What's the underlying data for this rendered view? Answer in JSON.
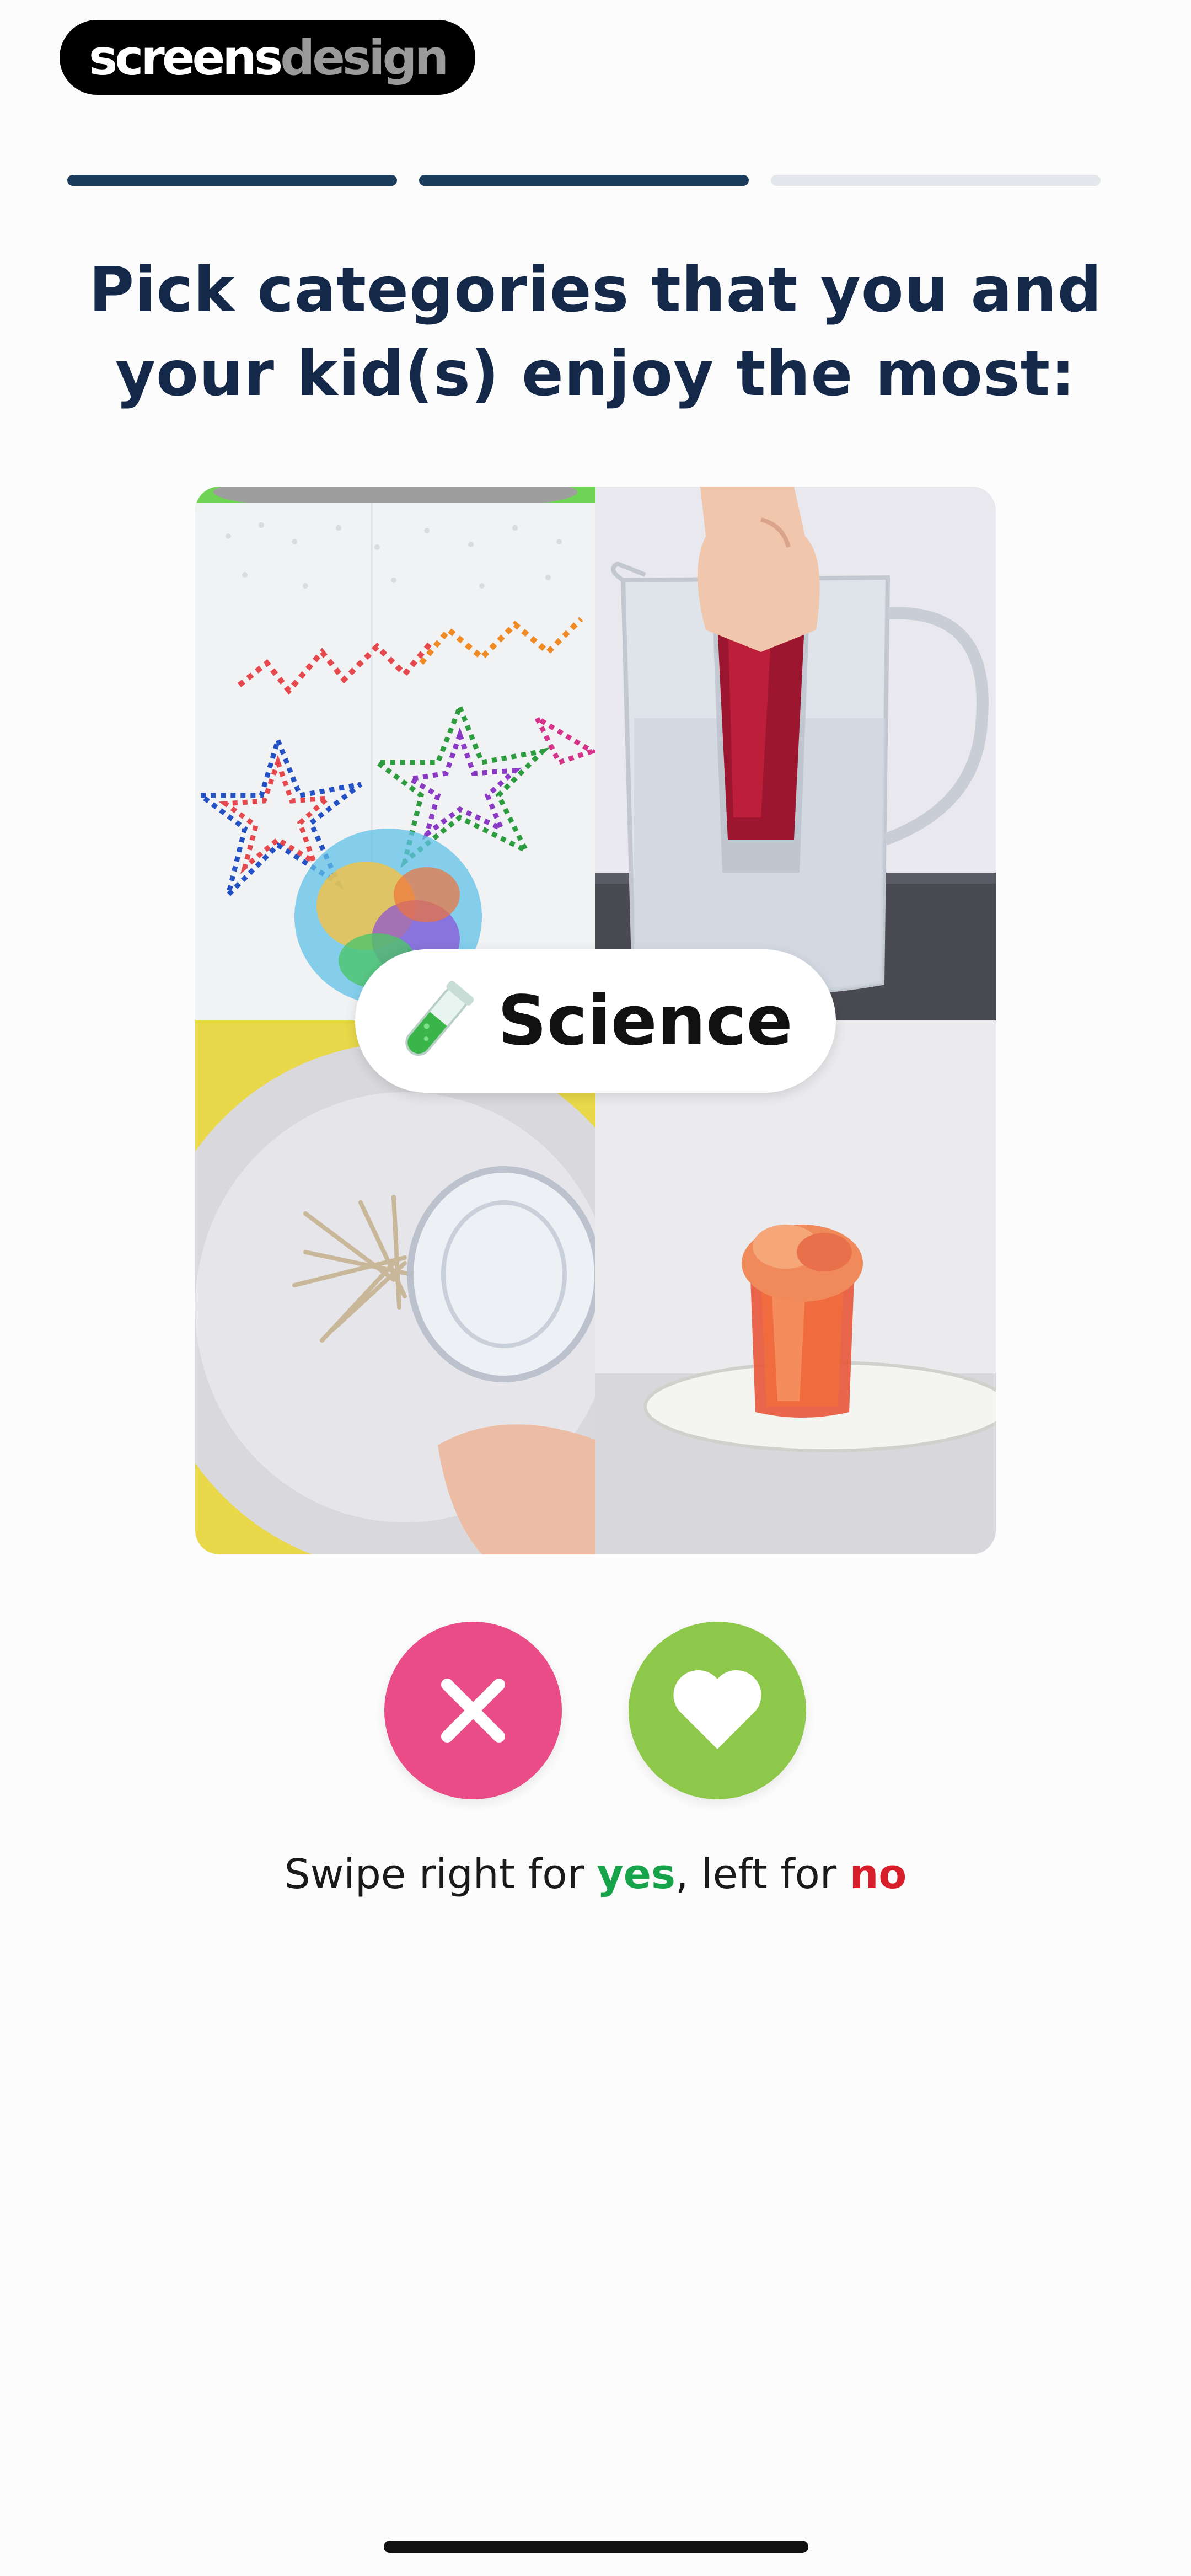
{
  "watermark": {
    "part1": "screens",
    "part2": "design"
  },
  "progress": {
    "total_steps": 3,
    "completed_steps": 2
  },
  "question": {
    "title": "Pick categories that you and your kid(s) enjoy the most:"
  },
  "card": {
    "category_label": "Science",
    "category_icon": "test-tube-icon",
    "images": [
      "paper-towel-marker-art",
      "glass-pitcher-red-liquid",
      "plate-toothpicks-glass",
      "red-foam-cup-on-plate"
    ]
  },
  "actions": {
    "reject_icon": "close-icon",
    "accept_icon": "heart-icon",
    "reject_color": "#e94c86",
    "accept_color": "#8ec84a"
  },
  "hint": {
    "prefix": "Swipe right for ",
    "yes": "yes",
    "middle": ", left for ",
    "no": "no",
    "yes_color": "#16a34a",
    "no_color": "#d71f2b"
  },
  "colors": {
    "accent": "#1b3d5b",
    "title": "#14294a"
  }
}
